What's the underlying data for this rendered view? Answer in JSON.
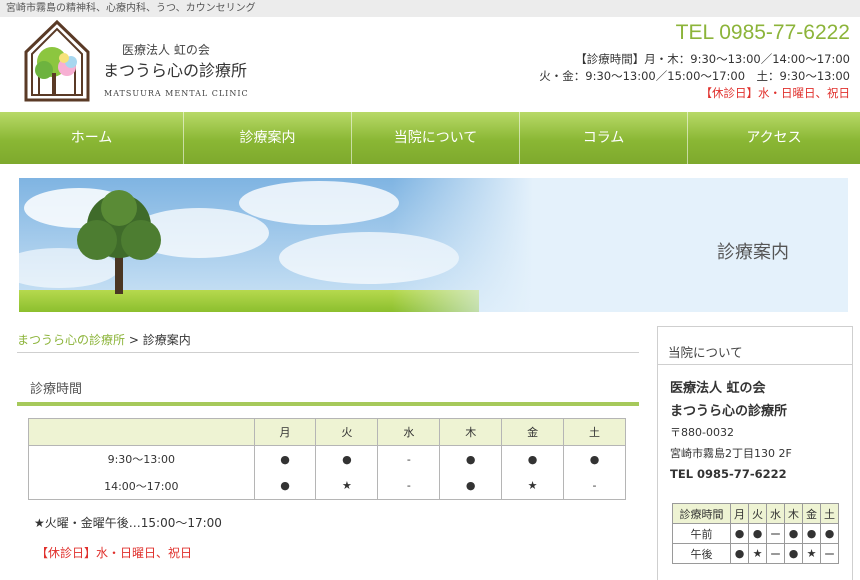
{
  "topbar": {
    "text": "宮崎市霧島の精神科、心療内科、うつ、カウンセリング"
  },
  "logo": {
    "icon": "house-tree-logo-icon",
    "org": "医療法人 虹の会",
    "name": "まつうら心の診療所",
    "english": "MATSUURA MENTAL CLINIC"
  },
  "header": {
    "tel": "TEL 0985-77-6222",
    "hours_line1": "【診療時間】月・木：9:30～13:00／14:00～17:00",
    "hours_line2": "火・金：9:30～13:00／15:00～17:00　土：9:30～13:00",
    "closed": "【休診日】水・日曜日、祝日"
  },
  "nav": {
    "items": [
      {
        "label": "ホーム"
      },
      {
        "label": "診療案内"
      },
      {
        "label": "当院について"
      },
      {
        "label": "コラム"
      },
      {
        "label": "アクセス"
      }
    ]
  },
  "banner": {
    "title": "診療案内"
  },
  "breadcrumb": {
    "home": "まつうら心の診療所",
    "sep": ">",
    "current": "診療案内"
  },
  "section": {
    "title": "診療時間"
  },
  "schedule": {
    "days": [
      "月",
      "火",
      "水",
      "木",
      "金",
      "土"
    ],
    "rows": [
      {
        "time": "9:30～13:00",
        "marks": [
          "●",
          "●",
          "-",
          "●",
          "●",
          "●"
        ]
      },
      {
        "time": "14:00～17:00",
        "marks": [
          "●",
          "★",
          "-",
          "●",
          "★",
          "-"
        ]
      }
    ]
  },
  "notes": {
    "star": "★火曜・金曜午後…15:00～17:00",
    "closed": "【休診日】水・日曜日、祝日"
  },
  "sidebar": {
    "heading": "当院について",
    "org": "医療法人 虹の会",
    "name": "まつうら心の診療所",
    "zip": "〒880-0032",
    "address": "宮崎市霧島2丁目130 2F",
    "tel": "TEL 0985-77-6222",
    "mini_table": {
      "header": "診療時間",
      "days": [
        "月",
        "火",
        "水",
        "木",
        "金",
        "土"
      ],
      "rows": [
        {
          "label": "午前",
          "marks": [
            "●",
            "●",
            "ー",
            "●",
            "●",
            "●"
          ]
        },
        {
          "label": "午後",
          "marks": [
            "●",
            "★",
            "ー",
            "●",
            "★",
            "ー"
          ]
        }
      ]
    }
  },
  "colors": {
    "accent": "#8cb43a",
    "closed": "#e0302c",
    "table_header": "#eef3d3"
  }
}
